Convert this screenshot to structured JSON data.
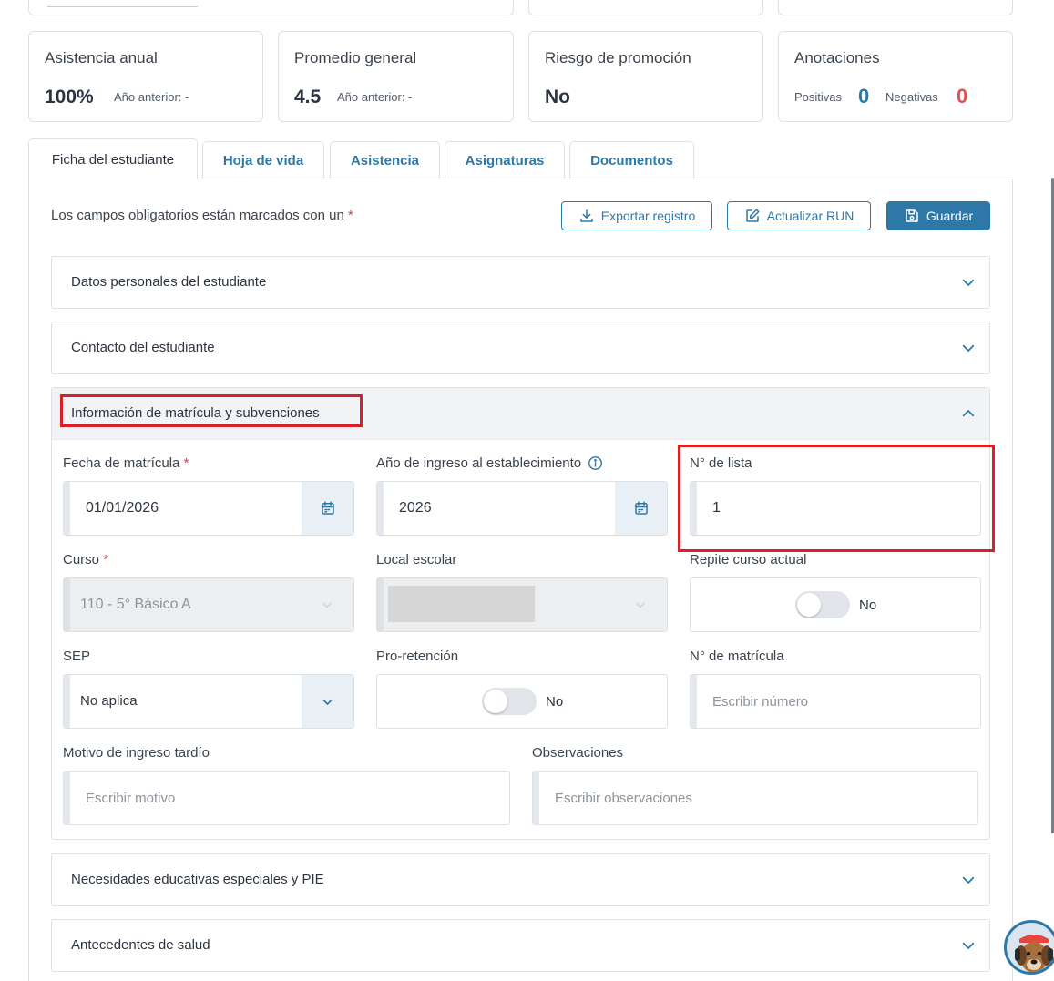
{
  "stats": {
    "attendance": {
      "title": "Asistencia anual",
      "value": "100%",
      "previous": "Año anterior: -"
    },
    "average": {
      "title": "Promedio general",
      "value": "4.5",
      "previous": "Año anterior: -"
    },
    "risk": {
      "title": "Riesgo de promoción",
      "value": "No"
    },
    "notes": {
      "title": "Anotaciones",
      "positive_label": "Positivas",
      "positive_count": "0",
      "negative_label": "Negativas",
      "negative_count": "0"
    }
  },
  "tabs": [
    {
      "label": "Ficha del estudiante",
      "active": true
    },
    {
      "label": "Hoja de vida"
    },
    {
      "label": "Asistencia"
    },
    {
      "label": "Asignaturas"
    },
    {
      "label": "Documentos"
    }
  ],
  "form": {
    "required_note": "Los campos obligatorios están marcados con un",
    "required_mark": "*",
    "buttons": {
      "export": "Exportar registro",
      "update_run": "Actualizar RUN",
      "save": "Guardar"
    }
  },
  "sections": {
    "personal": "Datos personales del estudiante",
    "contact": "Contacto del estudiante",
    "enrollment": "Información de matrícula y subvenciones",
    "special_needs": "Necesidades educativas especiales y PIE",
    "health": "Antecedentes de salud"
  },
  "enrollment": {
    "enroll_date": {
      "label": "Fecha de matrícula",
      "required": "*",
      "value": "01/01/2026"
    },
    "entry_year": {
      "label": "Año de ingreso al establecimiento",
      "value": "2026"
    },
    "list_number": {
      "label": "N° de lista",
      "value": "1"
    },
    "course": {
      "label": "Curso",
      "required": "*",
      "value": "110 - 5° Básico A"
    },
    "school_site": {
      "label": "Local escolar"
    },
    "repeats": {
      "label": "Repite curso actual",
      "value": "No"
    },
    "sep": {
      "label": "SEP",
      "value": "No aplica"
    },
    "pro_retention": {
      "label": "Pro-retención",
      "value": "No"
    },
    "enroll_number": {
      "label": "N° de matrícula",
      "placeholder": "Escribir número"
    },
    "late_reason": {
      "label": "Motivo de ingreso tardío",
      "placeholder": "Escribir motivo"
    },
    "observations": {
      "label": "Observaciones",
      "placeholder": "Escribir observaciones"
    }
  },
  "colors": {
    "accent": "#2e78a8",
    "negative": "#e05050",
    "highlight": "#d92027"
  }
}
